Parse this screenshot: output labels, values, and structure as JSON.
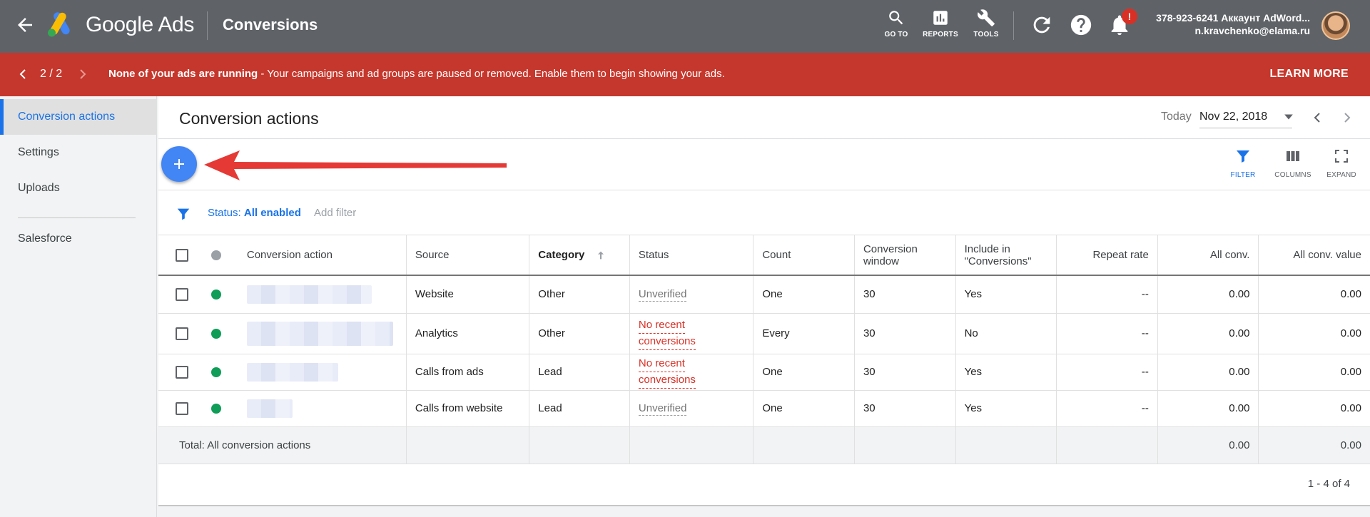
{
  "topbar": {
    "brand": "Google Ads",
    "page": "Conversions",
    "tools": [
      {
        "label": "GO TO",
        "icon": "search-icon"
      },
      {
        "label": "REPORTS",
        "icon": "bar-chart-icon"
      },
      {
        "label": "TOOLS",
        "icon": "wrench-icon"
      }
    ],
    "notification_badge": "!",
    "account_line": "378-923-6241 Аккаунт AdWord...",
    "email": "n.kravchenko@elama.ru"
  },
  "alert": {
    "counter": "2 / 2",
    "title": "None of your ads are running",
    "message": " - Your campaigns and ad groups are paused or removed. Enable them to begin showing your ads.",
    "action": "LEARN MORE",
    "color": "#c5372c"
  },
  "sidebar": {
    "items": [
      {
        "label": "Conversion actions",
        "active": true
      },
      {
        "label": "Settings"
      },
      {
        "label": "Uploads"
      },
      {
        "label": "Salesforce"
      }
    ]
  },
  "main": {
    "title": "Conversion actions",
    "date_label": "Today",
    "date_value": "Nov 22, 2018",
    "toolbar": [
      {
        "label": "FILTER",
        "icon": "filter-icon",
        "active": true
      },
      {
        "label": "COLUMNS",
        "icon": "columns-icon"
      },
      {
        "label": "EXPAND",
        "icon": "expand-icon"
      }
    ],
    "filter": {
      "status_label": "Status: ",
      "status_value": "All enabled",
      "add_filter": "Add filter"
    }
  },
  "table": {
    "headers": [
      "Conversion action",
      "Source",
      "Category",
      "Status",
      "Count",
      "Conversion window",
      "Include in \"Conversions\"",
      "Repeat rate",
      "All conv.",
      "All conv. value"
    ],
    "rows": [
      {
        "source": "Website",
        "category": "Other",
        "status": "Unverified",
        "count": "One",
        "window": "30",
        "include": "Yes",
        "repeat": "--",
        "all_conv": "0.00",
        "all_value": "0.00"
      },
      {
        "source": "Analytics",
        "category": "Other",
        "status_line1": "No recent",
        "status_line2": "conversions",
        "count": "Every",
        "window": "30",
        "include": "No",
        "repeat": "--",
        "all_conv": "0.00",
        "all_value": "0.00"
      },
      {
        "source": "Calls from ads",
        "category": "Lead",
        "status_line1": "No recent",
        "status_line2": "conversions",
        "count": "One",
        "window": "30",
        "include": "Yes",
        "repeat": "--",
        "all_conv": "0.00",
        "all_value": "0.00"
      },
      {
        "source": "Calls from website",
        "category": "Lead",
        "status": "Unverified",
        "count": "One",
        "window": "30",
        "include": "Yes",
        "repeat": "--",
        "all_conv": "0.00",
        "all_value": "0.00"
      }
    ],
    "total": {
      "label": "Total: All conversion actions",
      "all_conv": "0.00",
      "all_value": "0.00"
    },
    "pagination": "1 - 4 of 4"
  }
}
